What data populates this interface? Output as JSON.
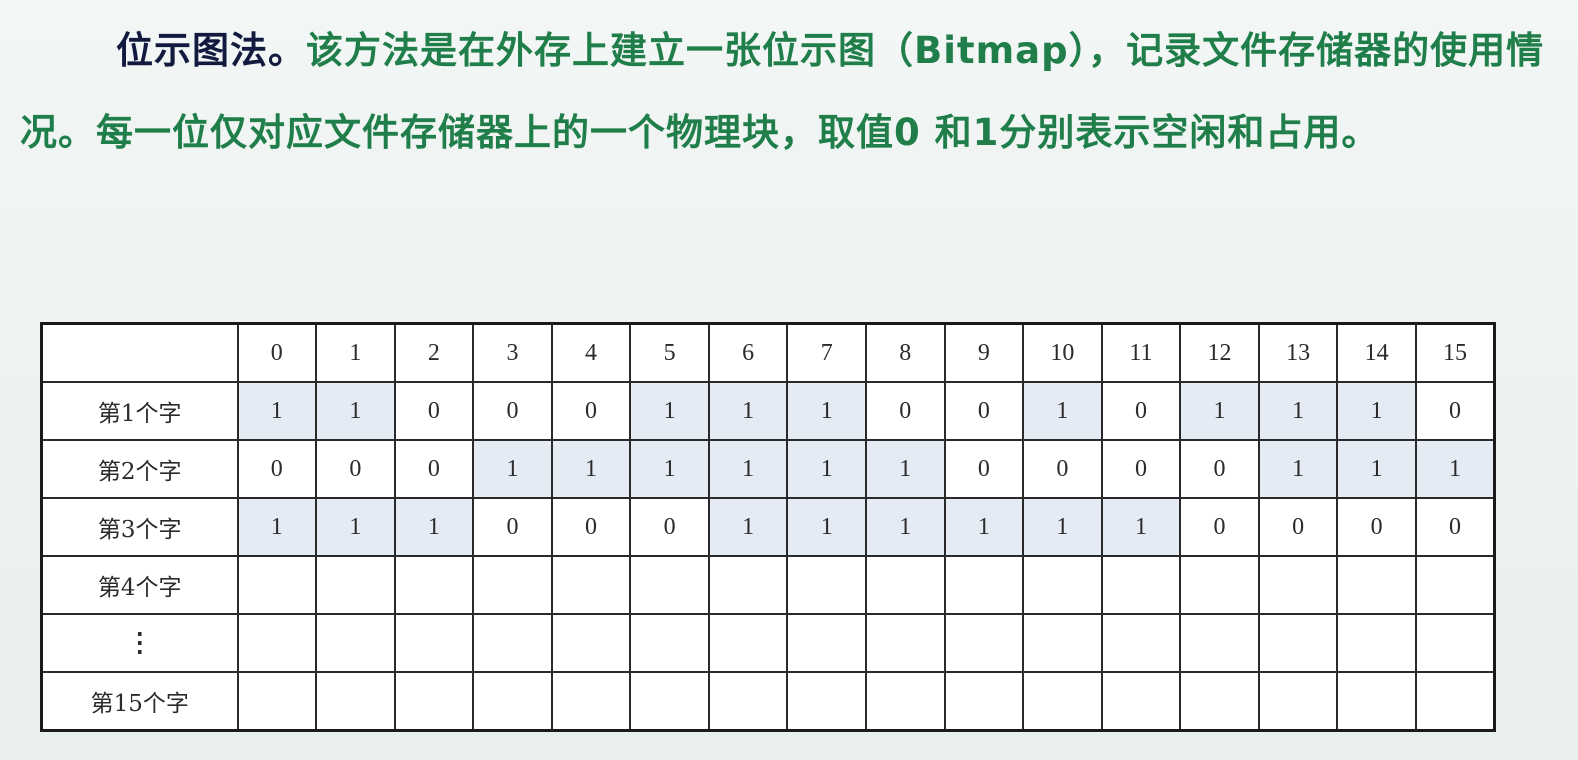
{
  "paragraph": {
    "term": "位示图法。",
    "text": "该方法是在外存上建立一张位示图（Bitmap），记录文件存储器的使用情况。每一位仅对应文件存储器上的一个物理块，取值0 和1分别表示空闲和占用。"
  },
  "table": {
    "column_headers": [
      "0",
      "1",
      "2",
      "3",
      "4",
      "5",
      "6",
      "7",
      "8",
      "9",
      "10",
      "11",
      "12",
      "13",
      "14",
      "15"
    ],
    "rows": [
      {
        "label": "第1个字",
        "bits": [
          "1",
          "1",
          "0",
          "0",
          "0",
          "1",
          "1",
          "1",
          "0",
          "0",
          "1",
          "0",
          "1",
          "1",
          "1",
          "0"
        ]
      },
      {
        "label": "第2个字",
        "bits": [
          "0",
          "0",
          "0",
          "1",
          "1",
          "1",
          "1",
          "1",
          "1",
          "0",
          "0",
          "0",
          "0",
          "1",
          "1",
          "1"
        ]
      },
      {
        "label": "第3个字",
        "bits": [
          "1",
          "1",
          "1",
          "0",
          "0",
          "0",
          "1",
          "1",
          "1",
          "1",
          "1",
          "1",
          "0",
          "0",
          "0",
          "0"
        ]
      },
      {
        "label": "第4个字",
        "bits": [
          "",
          "",
          "",
          "",
          "",
          "",
          "",
          "",
          "",
          "",
          "",
          "",
          "",
          "",
          "",
          ""
        ]
      },
      {
        "label": "⋮",
        "bits": [
          "",
          "",
          "",
          "",
          "",
          "",
          "",
          "",
          "",
          "",
          "",
          "",
          "",
          "",
          "",
          ""
        ]
      },
      {
        "label": "第15个字",
        "bits": [
          "",
          "",
          "",
          "",
          "",
          "",
          "",
          "",
          "",
          "",
          "",
          "",
          "",
          "",
          "",
          ""
        ]
      }
    ]
  }
}
